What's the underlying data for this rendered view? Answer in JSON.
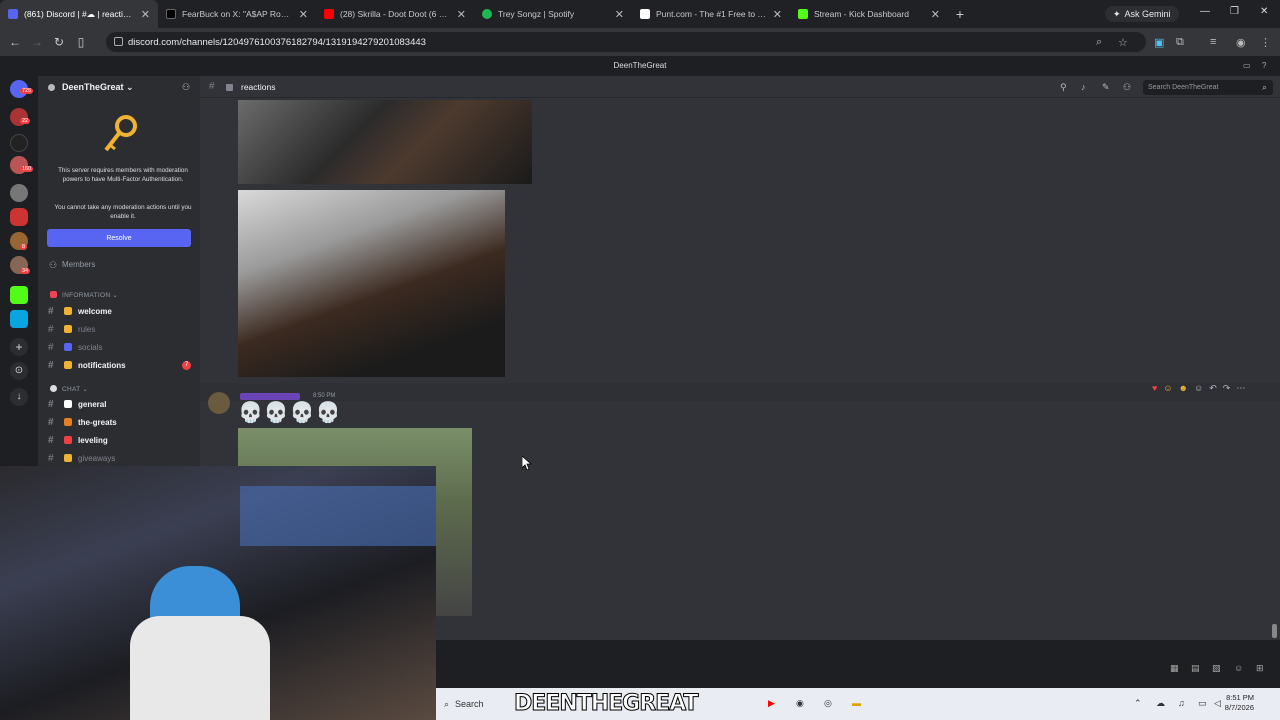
{
  "browser": {
    "tabs": [
      {
        "title": "(861) Discord | #☁ | reactions",
        "color": "#5865f2",
        "active": true
      },
      {
        "title": "FearBuck on X: \"A$AP Rocky gi",
        "color": "#000000"
      },
      {
        "title": "(28) Skrilla - Doot Doot (6 7) (O",
        "color": "#ff0000"
      },
      {
        "title": "Trey Songz | Spotify",
        "color": "#1db954"
      },
      {
        "title": "Punt.com - The #1 Free to Play",
        "color": "#ffffff"
      },
      {
        "title": "Stream - Kick Dashboard",
        "color": "#53fc18"
      }
    ],
    "gemini_label": "Ask Gemini",
    "url": "discord.com/channels/1204976100376182794/1319194279201083443"
  },
  "discord": {
    "top_title": "DeenTheGreat",
    "server_name": "DeenTheGreat",
    "mfa_text": "This server requires members with moderation powers to have Multi-Factor Authentication.",
    "mfa_text2": "You cannot take any moderation actions until you enable it.",
    "resolve_label": "Resolve",
    "members_label": "Members",
    "categories": {
      "information": "INFORMATION",
      "chat": "CHAT"
    },
    "channels_info": [
      {
        "name": "welcome",
        "emoji_color": "#f0b232",
        "bright": true
      },
      {
        "name": "rules",
        "emoji_color": "#f0b232",
        "bright": false
      },
      {
        "name": "socials",
        "emoji_color": "#5865f2",
        "bright": false
      },
      {
        "name": "notifications",
        "emoji_color": "#f0b232",
        "bright": true,
        "badge": "7"
      }
    ],
    "channels_chat": [
      {
        "name": "general",
        "emoji_color": "#ffffff",
        "bright": true
      },
      {
        "name": "the-greats",
        "emoji_color": "#e67e22",
        "bright": true
      },
      {
        "name": "leveling",
        "emoji_color": "#f23f42",
        "bright": true
      },
      {
        "name": "giveaways",
        "emoji_color": "#f0b232",
        "bright": false
      }
    ],
    "channel_title": "reactions",
    "search_placeholder": "Search DeenTheGreat",
    "message_time": "8:50 PM",
    "message_content": "💀💀💀💀",
    "guild_badges": [
      "725",
      "22",
      "160",
      "8",
      "34"
    ]
  },
  "taskbar": {
    "search_label": "Search",
    "overlay_text": "DEENTHEGREAT",
    "time": "8:51 PM",
    "date": "8/7/2026"
  }
}
